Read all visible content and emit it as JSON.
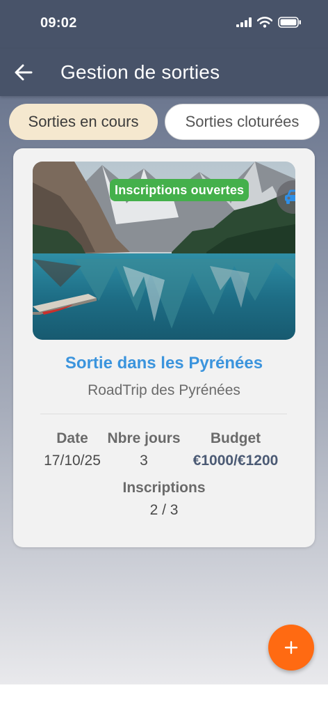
{
  "status_bar": {
    "time": "09:02",
    "icons": [
      "signal-icon",
      "wifi-icon",
      "battery-icon"
    ]
  },
  "app_bar": {
    "title": "Gestion de sorties",
    "back_icon": "arrow-left-icon"
  },
  "tabs": [
    {
      "label": "Sorties en cours",
      "active": true
    },
    {
      "label": "Sorties cloturées",
      "active": false
    }
  ],
  "card": {
    "badge": "Inscriptions ouvertes",
    "transport_icon": "car-icon",
    "title": "Sortie dans les Pyrénées",
    "subtitle": "RoadTrip des Pyrénées",
    "labels": {
      "date": "Date",
      "days": "Nbre jours",
      "budget": "Budget",
      "registrations": "Inscriptions"
    },
    "values": {
      "date": "17/10/25",
      "days": "3",
      "budget": "€1000/€1200",
      "registrations": "2 / 3"
    }
  },
  "fab": {
    "icon": "plus-icon",
    "label": "+"
  },
  "colors": {
    "header": "#485369",
    "accent_title": "#3b94dd",
    "badge": "#44b04b",
    "fab": "#ff6a12",
    "active_tab": "#f5e8cf"
  }
}
